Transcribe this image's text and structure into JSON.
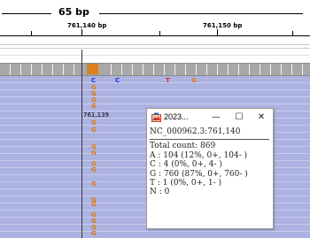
{
  "ruler": {
    "span_label": "65 bp",
    "tick_labels": [
      "761,140 bp",
      "761,150 bp"
    ]
  },
  "reads": {
    "consensus_bases": [
      {
        "base": "C",
        "color": "blue"
      },
      {
        "base": "C",
        "color": "blue"
      },
      {
        "base": "T",
        "color": "red"
      },
      {
        "base": "G",
        "color": "orange"
      }
    ],
    "position_label": "761,139",
    "column_bases": [
      "G",
      "G",
      "G",
      "G",
      "G",
      "G",
      "G",
      "G",
      "G",
      "G",
      "G",
      "G",
      "G",
      "G",
      "G",
      "G",
      "G"
    ]
  },
  "popup": {
    "title": "2023...",
    "minimize_glyph": "—",
    "maximize_glyph": "☐",
    "close_glyph": "✕",
    "locus": "NC_000962.3:761,140",
    "lines": [
      "Total count: 869",
      "A : 104 (12%, 0+, 104- )",
      "C : 4 (0%, 0+, 4- )",
      "G : 760 (87%, 0+, 760- )",
      "T : 1 (0%, 0+, 1- )",
      "N : 0"
    ]
  },
  "colors": {
    "read_fill": "#adb3e0",
    "coverage_gray": "#a8a8a8",
    "coverage_highlight": "#e07e1a",
    "base_c": "#1a2fd1",
    "base_t": "#e8202a",
    "base_g": "#d97918"
  }
}
